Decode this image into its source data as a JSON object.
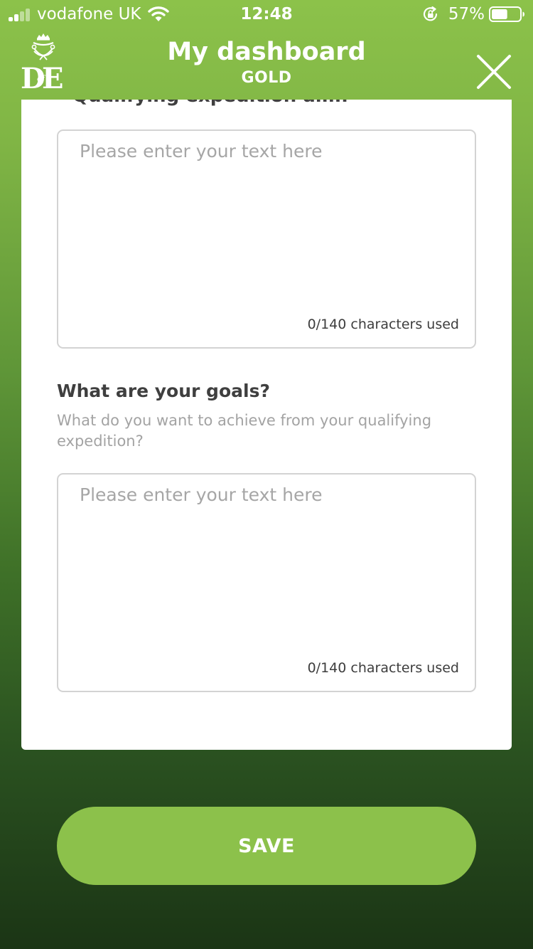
{
  "status_bar": {
    "carrier": "vodafone UK",
    "time": "12:48",
    "battery_percent": "57%",
    "battery_level": 0.57
  },
  "header": {
    "logo_icon": "dofe-logo",
    "title": "My dashboard",
    "subtitle": "GOLD",
    "close_icon": "close-icon"
  },
  "form": {
    "aim_heading_partial": "Qualifying expedition aim:",
    "aim_field": {
      "value": "",
      "placeholder": "Please enter your text here",
      "counter": "0/140 characters used"
    },
    "goals_heading": "What are your goals?",
    "goals_description": "What do you want to achieve from your qualifying expedition?",
    "goals_field": {
      "value": "",
      "placeholder": "Please enter your text here",
      "counter": "0/140 characters used"
    }
  },
  "save_button": {
    "label": "SAVE"
  },
  "colors": {
    "brand_green": "#8cc14b",
    "background_dark": "#1b3515"
  }
}
